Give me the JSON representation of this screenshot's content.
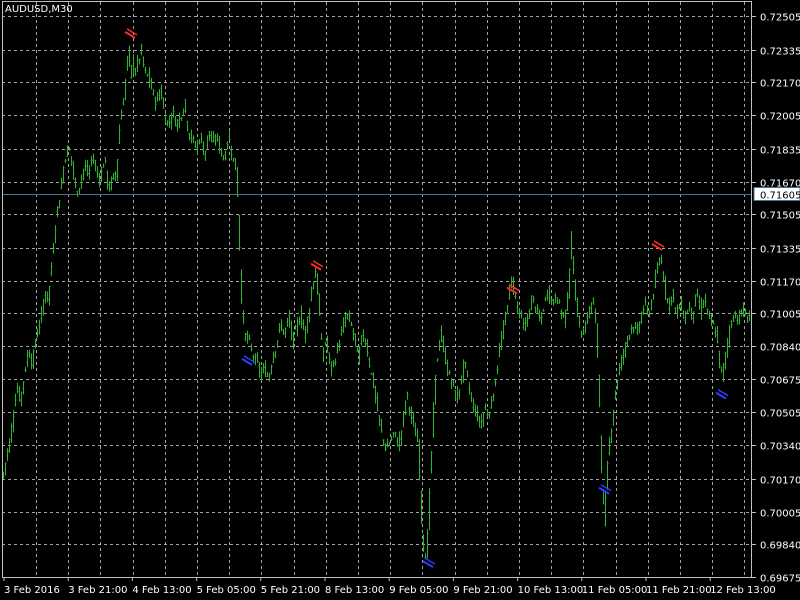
{
  "window": {
    "symbol_title": "AUDUSD,M30"
  },
  "colors": {
    "background": "#000000",
    "grid": "#c0c0c0",
    "frame": "#c0c0c0",
    "bars": "#2fb22f",
    "current_price_line": "#4a6f8a",
    "fractal_up": "#ff2a2a",
    "fractal_down": "#2a3cff",
    "label_text": "#ffffff"
  },
  "chart_data": {
    "type": "bar",
    "symbol": "AUDUSD",
    "timeframe": "M30",
    "grid": true,
    "current_price": 0.71605,
    "y_ticks": [
      0.72505,
      0.72335,
      0.7217,
      0.72005,
      0.71835,
      0.7167,
      0.71505,
      0.71335,
      0.7117,
      0.71005,
      0.7084,
      0.70675,
      0.70505,
      0.7034,
      0.7017,
      0.70005,
      0.6984,
      0.69675
    ],
    "y_tick_labels": [
      "0.72505",
      "0.72335",
      "0.72170",
      "0.72005",
      "0.71835",
      "0.71670",
      "0.71505",
      "0.71335",
      "0.71170",
      "0.71005",
      "0.70840",
      "0.70675",
      "0.70505",
      "0.70340",
      "0.70170",
      "0.70005",
      "0.69840",
      "0.69675"
    ],
    "ylim": [
      0.69675,
      0.72505
    ],
    "x_tick_labels": [
      "3 Feb 2016",
      "3 Feb 21:00",
      "4 Feb 13:00",
      "5 Feb 05:00",
      "5 Feb 21:00",
      "8 Feb 13:00",
      "9 Feb 05:00",
      "9 Feb 21:00",
      "10 Feb 13:00",
      "11 Feb 05:00",
      "11 Feb 21:00",
      "12 Feb 13:00"
    ],
    "close_path": [
      [
        0,
        0.7024
      ],
      [
        3,
        0.7018
      ],
      [
        6,
        0.7029
      ],
      [
        9,
        0.7035
      ],
      [
        12,
        0.7046
      ],
      [
        16,
        0.7063
      ],
      [
        20,
        0.7057
      ],
      [
        24,
        0.707
      ],
      [
        28,
        0.7082
      ],
      [
        32,
        0.7075
      ],
      [
        36,
        0.709
      ],
      [
        40,
        0.7096
      ],
      [
        44,
        0.711
      ],
      [
        48,
        0.7108
      ],
      [
        52,
        0.713
      ],
      [
        56,
        0.715
      ],
      [
        60,
        0.7162
      ],
      [
        64,
        0.7178
      ],
      [
        68,
        0.7185
      ],
      [
        72,
        0.7175
      ],
      [
        76,
        0.716
      ],
      [
        80,
        0.7167
      ],
      [
        84,
        0.7175
      ],
      [
        88,
        0.717
      ],
      [
        92,
        0.718
      ],
      [
        96,
        0.7172
      ],
      [
        100,
        0.7169
      ],
      [
        104,
        0.7179
      ],
      [
        108,
        0.7163
      ],
      [
        112,
        0.7168
      ],
      [
        116,
        0.7172
      ],
      [
        120,
        0.72
      ],
      [
        124,
        0.721
      ],
      [
        126,
        0.7225
      ],
      [
        128,
        0.7232
      ],
      [
        130,
        0.722
      ],
      [
        132,
        0.7228
      ],
      [
        135,
        0.7222
      ],
      [
        138,
        0.7228
      ],
      [
        141,
        0.7233
      ],
      [
        144,
        0.7222
      ],
      [
        148,
        0.722
      ],
      [
        152,
        0.7212
      ],
      [
        156,
        0.7207
      ],
      [
        160,
        0.7214
      ],
      [
        164,
        0.72
      ],
      [
        168,
        0.7196
      ],
      [
        172,
        0.7202
      ],
      [
        176,
        0.7196
      ],
      [
        180,
        0.72
      ],
      [
        184,
        0.7206
      ],
      [
        188,
        0.7192
      ],
      [
        192,
        0.7188
      ],
      [
        196,
        0.7184
      ],
      [
        200,
        0.719
      ],
      [
        204,
        0.718
      ],
      [
        208,
        0.7192
      ],
      [
        212,
        0.7186
      ],
      [
        216,
        0.719
      ],
      [
        220,
        0.7183
      ],
      [
        224,
        0.7178
      ],
      [
        228,
        0.719
      ],
      [
        232,
        0.718
      ],
      [
        236,
        0.7172
      ],
      [
        238,
        0.715
      ],
      [
        240,
        0.712
      ],
      [
        242,
        0.71
      ],
      [
        244,
        0.709
      ],
      [
        248,
        0.7087
      ],
      [
        252,
        0.708
      ],
      [
        256,
        0.7076
      ],
      [
        260,
        0.707
      ],
      [
        264,
        0.7072
      ],
      [
        268,
        0.7068
      ],
      [
        272,
        0.7078
      ],
      [
        276,
        0.7085
      ],
      [
        280,
        0.7095
      ],
      [
        284,
        0.709
      ],
      [
        288,
        0.7098
      ],
      [
        292,
        0.7087
      ],
      [
        296,
        0.7093
      ],
      [
        300,
        0.71
      ],
      [
        304,
        0.709
      ],
      [
        308,
        0.71
      ],
      [
        312,
        0.7115
      ],
      [
        315,
        0.7122
      ],
      [
        318,
        0.7108
      ],
      [
        320,
        0.709
      ],
      [
        322,
        0.708
      ],
      [
        326,
        0.7087
      ],
      [
        330,
        0.7072
      ],
      [
        334,
        0.7076
      ],
      [
        338,
        0.7085
      ],
      [
        342,
        0.7092
      ],
      [
        346,
        0.71
      ],
      [
        350,
        0.7096
      ],
      [
        354,
        0.7088
      ],
      [
        358,
        0.7078
      ],
      [
        362,
        0.709
      ],
      [
        366,
        0.7085
      ],
      [
        370,
        0.7072
      ],
      [
        374,
        0.7062
      ],
      [
        378,
        0.7048
      ],
      [
        382,
        0.7038
      ],
      [
        386,
        0.7032
      ],
      [
        390,
        0.7036
      ],
      [
        394,
        0.704
      ],
      [
        398,
        0.7034
      ],
      [
        402,
        0.7044
      ],
      [
        406,
        0.706
      ],
      [
        410,
        0.705
      ],
      [
        414,
        0.7042
      ],
      [
        418,
        0.7034
      ],
      [
        420,
        0.7008
      ],
      [
        422,
        0.699
      ],
      [
        424,
        0.6978
      ],
      [
        426,
        0.698
      ],
      [
        428,
        0.6995
      ],
      [
        430,
        0.702
      ],
      [
        432,
        0.704
      ],
      [
        434,
        0.706
      ],
      [
        436,
        0.7075
      ],
      [
        440,
        0.709
      ],
      [
        444,
        0.708
      ],
      [
        448,
        0.707
      ],
      [
        452,
        0.7065
      ],
      [
        456,
        0.7057
      ],
      [
        460,
        0.7065
      ],
      [
        464,
        0.7076
      ],
      [
        468,
        0.7064
      ],
      [
        472,
        0.7055
      ],
      [
        476,
        0.705
      ],
      [
        480,
        0.7045
      ],
      [
        484,
        0.7052
      ],
      [
        488,
        0.705
      ],
      [
        492,
        0.7058
      ],
      [
        496,
        0.707
      ],
      [
        500,
        0.7085
      ],
      [
        504,
        0.7095
      ],
      [
        508,
        0.711
      ],
      [
        512,
        0.7118
      ],
      [
        516,
        0.7105
      ],
      [
        520,
        0.71
      ],
      [
        524,
        0.7092
      ],
      [
        528,
        0.71
      ],
      [
        532,
        0.7108
      ],
      [
        536,
        0.7102
      ],
      [
        540,
        0.7096
      ],
      [
        544,
        0.7106
      ],
      [
        548,
        0.7112
      ],
      [
        552,
        0.7105
      ],
      [
        556,
        0.711
      ],
      [
        560,
        0.7102
      ],
      [
        564,
        0.7098
      ],
      [
        568,
        0.711
      ],
      [
        570,
        0.714
      ],
      [
        572,
        0.7125
      ],
      [
        576,
        0.7105
      ],
      [
        580,
        0.709
      ],
      [
        584,
        0.7093
      ],
      [
        588,
        0.71
      ],
      [
        592,
        0.7108
      ],
      [
        596,
        0.7092
      ],
      [
        598,
        0.707
      ],
      [
        600,
        0.704
      ],
      [
        602,
        0.701
      ],
      [
        604,
        0.6995
      ],
      [
        606,
        0.7015
      ],
      [
        608,
        0.703
      ],
      [
        612,
        0.7048
      ],
      [
        616,
        0.7065
      ],
      [
        620,
        0.7075
      ],
      [
        624,
        0.7082
      ],
      [
        628,
        0.709
      ],
      [
        632,
        0.7095
      ],
      [
        636,
        0.709
      ],
      [
        640,
        0.7098
      ],
      [
        644,
        0.7105
      ],
      [
        648,
        0.71
      ],
      [
        652,
        0.7108
      ],
      [
        656,
        0.712
      ],
      [
        660,
        0.713
      ],
      [
        664,
        0.7115
      ],
      [
        668,
        0.7105
      ],
      [
        672,
        0.711
      ],
      [
        676,
        0.71
      ],
      [
        680,
        0.7106
      ],
      [
        684,
        0.7098
      ],
      [
        688,
        0.7104
      ],
      [
        692,
        0.71
      ],
      [
        696,
        0.711
      ],
      [
        700,
        0.7102
      ],
      [
        704,
        0.7108
      ],
      [
        708,
        0.7098
      ],
      [
        712,
        0.7095
      ],
      [
        716,
        0.709
      ],
      [
        718,
        0.708
      ],
      [
        720,
        0.7072
      ],
      [
        722,
        0.7068
      ],
      [
        724,
        0.7076
      ],
      [
        726,
        0.7082
      ],
      [
        730,
        0.7095
      ],
      [
        734,
        0.71
      ],
      [
        738,
        0.7098
      ],
      [
        742,
        0.7102
      ],
      [
        746,
        0.7098
      ],
      [
        750,
        0.7101
      ]
    ],
    "fractals_up": [
      [
        130,
        0.7241
      ],
      [
        316,
        0.7124
      ],
      [
        512,
        0.7112
      ],
      [
        657,
        0.7134
      ]
    ],
    "fractals_down": [
      [
        247,
        0.7076
      ],
      [
        428,
        0.6974
      ],
      [
        604,
        0.7011
      ],
      [
        721,
        0.7059
      ]
    ]
  }
}
